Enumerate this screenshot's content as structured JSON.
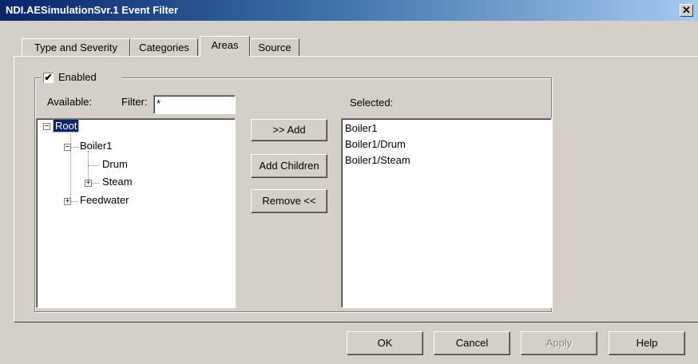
{
  "window": {
    "title": "NDI.AESimulationSvr.1 Event Filter",
    "close_glyph": "✕"
  },
  "tabs": [
    {
      "label": "Type and Severity",
      "active": false
    },
    {
      "label": "Categories",
      "active": false
    },
    {
      "label": "Areas",
      "active": true
    },
    {
      "label": "Source",
      "active": false
    }
  ],
  "areas": {
    "enabled": {
      "label": "Enabled",
      "checked": true,
      "check_glyph": "✔"
    },
    "available_label": "Available:",
    "filter": {
      "label": "Filter:",
      "value": "*"
    },
    "selected_label": "Selected:",
    "tree": {
      "root": "Root",
      "boiler1": "Boiler1",
      "drum": "Drum",
      "steam": "Steam",
      "feedwater": "Feedwater",
      "expanded_glyph": "−",
      "collapsed_glyph": "+"
    },
    "buttons": {
      "add": ">> Add",
      "add_children": "Add Children",
      "remove": "Remove <<"
    },
    "selected_items": [
      "Boiler1",
      "Boiler1/Drum",
      "Boiler1/Steam"
    ]
  },
  "footer": {
    "ok": "OK",
    "cancel": "Cancel",
    "apply": "Apply",
    "help": "Help"
  }
}
